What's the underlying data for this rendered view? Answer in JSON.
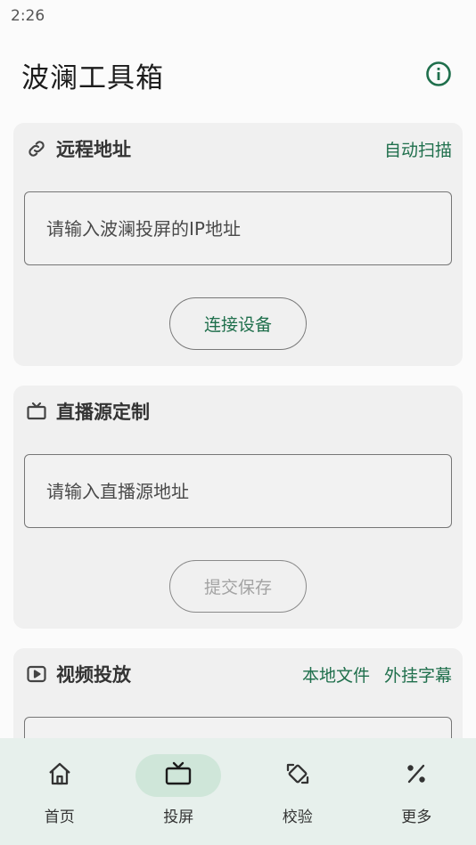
{
  "status_bar": {
    "time": "2:26"
  },
  "header": {
    "title": "波澜工具箱",
    "info_icon": "info-icon"
  },
  "remote_card": {
    "icon": "link-icon",
    "title": "远程地址",
    "action": "自动扫描",
    "input_placeholder": "请输入波澜投屏的IP地址",
    "input_value": "",
    "button_label": "连接设备"
  },
  "live_card": {
    "icon": "tv-icon",
    "title": "直播源定制",
    "input_placeholder": "请输入直播源地址",
    "input_value": "",
    "button_label": "提交保存"
  },
  "video_card": {
    "icon": "play-icon",
    "title": "视频投放",
    "actions": [
      "本地文件",
      "外挂字幕"
    ]
  },
  "bottom_nav": {
    "items": [
      {
        "label": "首页",
        "icon": "home-icon",
        "selected": false
      },
      {
        "label": "投屏",
        "icon": "tv-icon",
        "selected": true
      },
      {
        "label": "校验",
        "icon": "verify-icon",
        "selected": false
      },
      {
        "label": "更多",
        "icon": "percent-icon",
        "selected": false
      }
    ]
  },
  "colors": {
    "accent": "#1f6f4c",
    "nav_background": "#e7f0ec",
    "nav_selected": "#cfe6d9",
    "card_background": "#f0f0f0"
  }
}
